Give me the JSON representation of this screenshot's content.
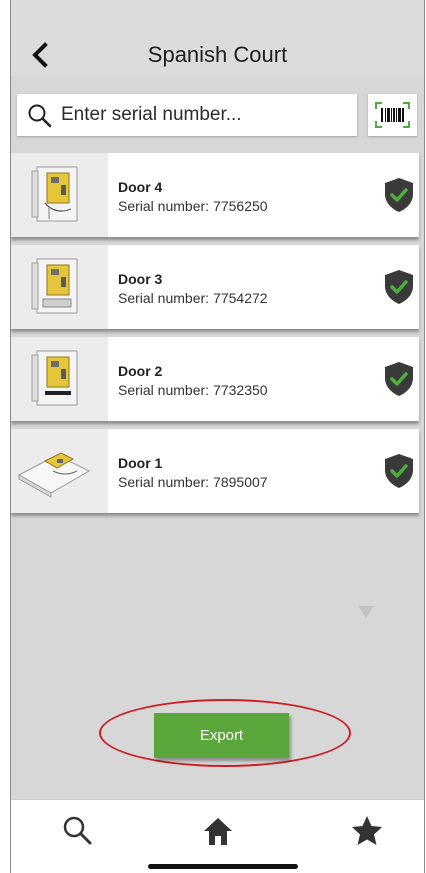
{
  "header": {
    "title": "Spanish Court"
  },
  "search": {
    "placeholder": "Enter serial number..."
  },
  "devices": [
    {
      "name": "Door 4",
      "serial_label": "Serial number:",
      "serial": "7756250",
      "status_icon": "verified-shield-icon"
    },
    {
      "name": "Door 3",
      "serial_label": "Serial number:",
      "serial": "7754272",
      "status_icon": "verified-shield-icon"
    },
    {
      "name": "Door 2",
      "serial_label": "Serial number:",
      "serial": "7732350",
      "status_icon": "verified-shield-icon"
    },
    {
      "name": "Door 1",
      "serial_label": "Serial number:",
      "serial": "7895007",
      "status_icon": "verified-shield-icon"
    }
  ],
  "actions": {
    "export_label": "Export"
  },
  "tabbar": {
    "items": [
      "search-icon",
      "home-icon",
      "star-icon"
    ]
  },
  "colors": {
    "accent_green": "#5aa63a",
    "check_green": "#4caf3a",
    "shield": "#3a3a3a",
    "annotation_red": "#cc2026"
  }
}
